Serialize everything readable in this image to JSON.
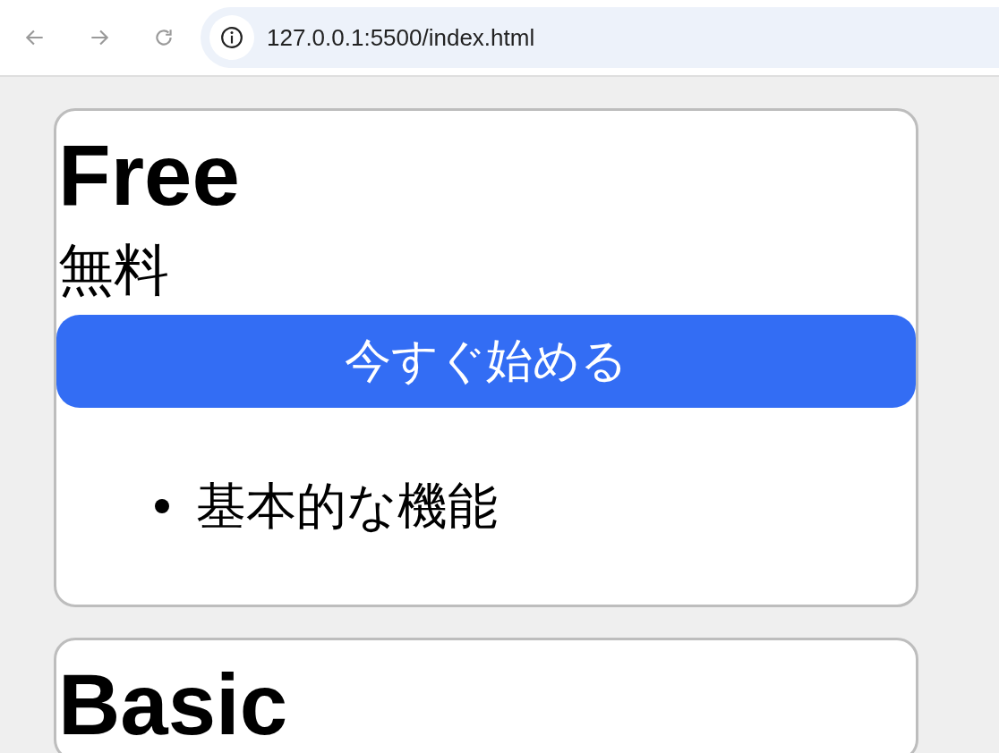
{
  "browser": {
    "url": "127.0.0.1:5500/index.html"
  },
  "plans": [
    {
      "name": "Free",
      "price": "無料",
      "button": "今すぐ始める",
      "features": [
        "基本的な機能"
      ]
    },
    {
      "name": "Basic"
    }
  ]
}
